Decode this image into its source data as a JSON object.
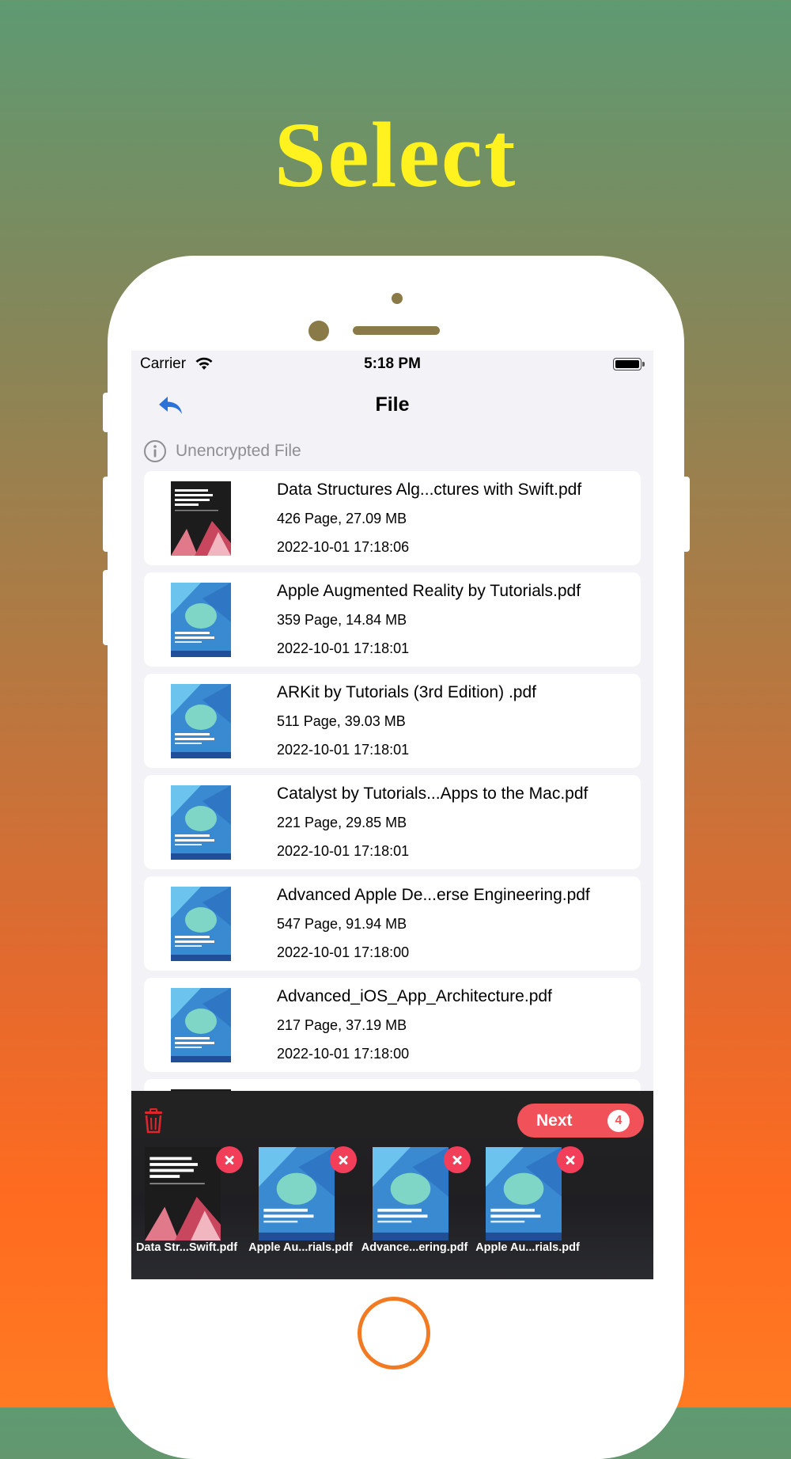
{
  "headline": "Select",
  "status": {
    "carrier": "Carrier",
    "time": "5:18 PM"
  },
  "nav": {
    "title": "File"
  },
  "section": {
    "label": "Unencrypted File"
  },
  "files": [
    {
      "title": "Data Structures  Alg...ctures with Swift.pdf",
      "meta": "426 Page, 27.09 MB",
      "date": "2022-10-01 17:18:06",
      "cover": "dark",
      "cover_text": "Data Structures & Algorithms in Swift"
    },
    {
      "title": "Apple Augmented Reality by Tutorials.pdf",
      "meta": "359 Page, 14.84 MB",
      "date": "2022-10-01 17:18:01",
      "cover": "blue",
      "cover_text": "Apple Augmented Reality by Tutorials"
    },
    {
      "title": "ARKit by Tutorials (3rd Edition) .pdf",
      "meta": "511 Page, 39.03 MB",
      "date": "2022-10-01 17:18:01",
      "cover": "blue",
      "cover_text": "ARKit by Tutorials"
    },
    {
      "title": "Catalyst by Tutorials...Apps to the Mac.pdf",
      "meta": "221 Page, 29.85 MB",
      "date": "2022-10-01 17:18:01",
      "cover": "blue",
      "cover_text": "Catalyst by Tutorials"
    },
    {
      "title": "Advanced Apple De...erse Engineering.pdf",
      "meta": "547 Page, 91.94 MB",
      "date": "2022-10-01 17:18:00",
      "cover": "blue",
      "cover_text": "Advanced Apple Debugging & Reverse Engineering"
    },
    {
      "title": "Advanced_iOS_App_Architecture.pdf",
      "meta": "217 Page, 37.19 MB",
      "date": "2022-10-01 17:18:00",
      "cover": "blue",
      "cover_text": "Advanced iOS App Architecture"
    }
  ],
  "tray": {
    "next_label": "Next",
    "count": "4",
    "selected": [
      {
        "name": "Data Str...Swift.pdf",
        "cover": "dark",
        "cover_text": "Data Structures & Algorithms in Swift"
      },
      {
        "name": "Apple Au...rials.pdf",
        "cover": "blue",
        "cover_text": "Apple Augmented Reality by Tutorials"
      },
      {
        "name": "Advance...ering.pdf",
        "cover": "blue",
        "cover_text": "Advanced Apple Debugging & Reverse Engineering"
      },
      {
        "name": "Apple Au...rials.pdf",
        "cover": "blue",
        "cover_text": "Apple Augmented Reality by Tutorials"
      }
    ]
  },
  "colors": {
    "accent": "#f1525a",
    "back": "#2b73d6",
    "trash": "#e0262d"
  }
}
